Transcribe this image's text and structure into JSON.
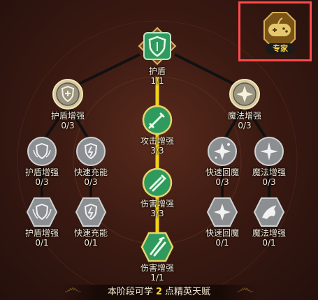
{
  "expert_badge": {
    "label": "专家",
    "icon": "gamepad-icon"
  },
  "nodes": {
    "shield": {
      "name": "护盾",
      "level": "1/1",
      "icon": "shield-icon"
    },
    "shield_boost": {
      "name": "护盾增强",
      "level": "0/3",
      "icon": "shield-plus-icon"
    },
    "magic_boost": {
      "name": "魔法增强",
      "level": "0/3",
      "icon": "magic-star-icon"
    },
    "attack_boost": {
      "name": "攻击增强",
      "level": "3/3",
      "icon": "sword-icon"
    },
    "damage_boost_1": {
      "name": "伤害增强",
      "level": "3/3",
      "icon": "double-sword-icon"
    },
    "damage_boost_2": {
      "name": "伤害增强",
      "level": "1/1",
      "icon": "crossed-swords-icon"
    },
    "shield_boost_2": {
      "name": "护盾增强",
      "level": "0/3",
      "icon": "shield-wings-icon"
    },
    "fast_charge_1": {
      "name": "快速充能",
      "level": "0/3",
      "icon": "shield-bolt-icon"
    },
    "fast_mana_1": {
      "name": "快速回魔",
      "level": "0/3",
      "icon": "sparkle-icon"
    },
    "magic_boost_2": {
      "name": "魔法增强",
      "level": "0/3",
      "icon": "star-burst-icon"
    },
    "shield_boost_3": {
      "name": "护盾增强",
      "level": "0/1",
      "icon": "shield-crown-icon"
    },
    "fast_charge_2": {
      "name": "快速充能",
      "level": "0/1",
      "icon": "shield-bolt-icon"
    },
    "fast_mana_2": {
      "name": "快速回魔",
      "level": "0/1",
      "icon": "star-wings-icon"
    },
    "magic_boost_3": {
      "name": "魔法增强",
      "level": "0/1",
      "icon": "dragon-icon"
    }
  },
  "footer": {
    "prefix": "本阶段可学",
    "points": "2",
    "suffix": "点精英天赋"
  },
  "colors": {
    "active": "#2f9a5e",
    "active_line": "#f2d21c",
    "gold": "#c9a24a",
    "locked": "#8a8f95",
    "line": "#101010"
  }
}
